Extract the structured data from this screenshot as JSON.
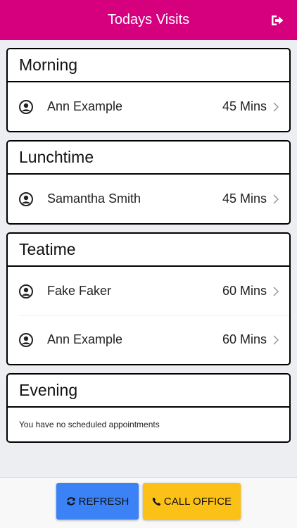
{
  "header": {
    "title": "Todays Visits",
    "logout_icon": "sign-out-icon"
  },
  "sections": [
    {
      "title": "Morning",
      "visits": [
        {
          "name": "Ann Example",
          "duration": "45 Mins"
        }
      ]
    },
    {
      "title": "Lunchtime",
      "visits": [
        {
          "name": "Samantha Smith",
          "duration": "45 Mins"
        }
      ]
    },
    {
      "title": "Teatime",
      "visits": [
        {
          "name": "Fake Faker",
          "duration": "60 Mins"
        },
        {
          "name": "Ann Example",
          "duration": "60 Mins"
        }
      ]
    },
    {
      "title": "Evening",
      "visits": [],
      "empty_message": "You have no scheduled appointments"
    }
  ],
  "footer": {
    "refresh_label": "REFRESH",
    "call_label": "CALL OFFICE"
  },
  "colors": {
    "header_bg": "#d6007e",
    "refresh_bg": "#3b82f6",
    "call_bg": "#fbc117"
  }
}
